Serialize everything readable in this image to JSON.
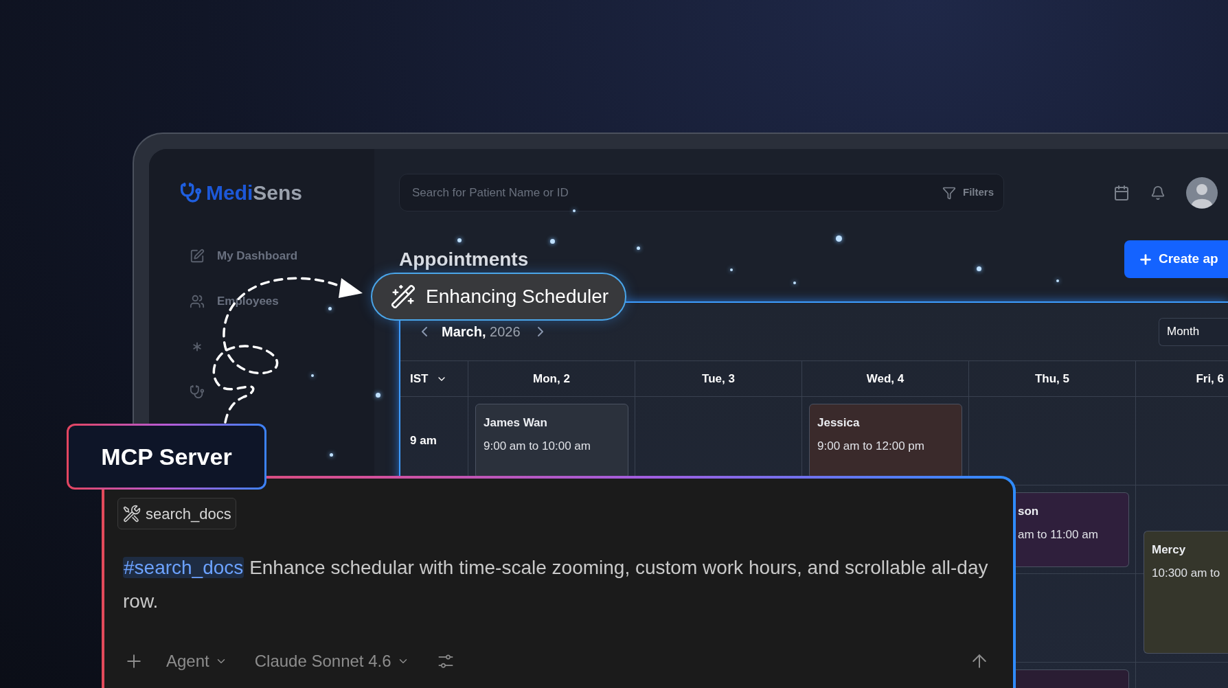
{
  "app": {
    "logo": {
      "part_1": "Medi",
      "part_2": "Sens"
    },
    "sidebar": {
      "items": [
        {
          "kind": "labeled",
          "label": "My Dashboard"
        },
        {
          "kind": "labeled",
          "label": "Employees"
        },
        {
          "kind": "icon_only"
        },
        {
          "kind": "icon_only"
        }
      ]
    },
    "search": {
      "placeholder": "Search for Patient Name or ID"
    },
    "filters_button": "Filters",
    "page_title": "Appointments",
    "create_button": "Create ap"
  },
  "callout": {
    "title": "Enhancing Scheduler"
  },
  "calendar": {
    "month": "March,",
    "year": "2026",
    "view": "Month",
    "timezone": "IST",
    "days": [
      "Mon, 2",
      "Tue, 3",
      "Wed, 4",
      "Thu, 5",
      "Fri, 6"
    ],
    "rows": [
      {
        "time": "9 am",
        "cells": [
          {
            "kind": "event",
            "title": "James Wan",
            "time": "9:00 am to 10:00 am",
            "color": "#2b313c"
          },
          {
            "kind": "empty"
          },
          {
            "kind": "event",
            "title": "Jessica",
            "time": "9:00 am to 12:00 pm",
            "color": "#3a2a2b"
          },
          {
            "kind": "empty"
          },
          {
            "kind": "empty"
          }
        ]
      },
      {
        "cells": [
          {
            "kind": "empty"
          },
          {
            "kind": "empty"
          },
          {
            "kind": "empty"
          },
          {
            "kind": "event_partial",
            "title": "son",
            "time": "am to 11:00 am",
            "color": "#2f1f3c"
          },
          {
            "kind": "event_half",
            "title": "Mercy",
            "time": "10:300 am to",
            "color": "#35362b"
          }
        ]
      },
      {
        "cells": [
          {
            "kind": "empty"
          },
          {
            "kind": "empty"
          },
          {
            "kind": "empty"
          },
          {
            "kind": "empty"
          },
          {
            "kind": "empty"
          }
        ]
      },
      {
        "cells": [
          {
            "kind": "empty"
          },
          {
            "kind": "empty"
          },
          {
            "kind": "empty"
          },
          {
            "kind": "event_partial",
            "color": "#2a1d33"
          },
          {
            "kind": "empty"
          }
        ]
      }
    ]
  },
  "mcp_badge": "MCP Server",
  "chat": {
    "tool_chip": "search_docs",
    "mention": "#search_docs",
    "prompt": "Enhance schedular with time-scale zooming, custom work hours, and scrollable all-day row.",
    "mode": "Agent",
    "model": "Claude Sonnet 4.6"
  }
}
